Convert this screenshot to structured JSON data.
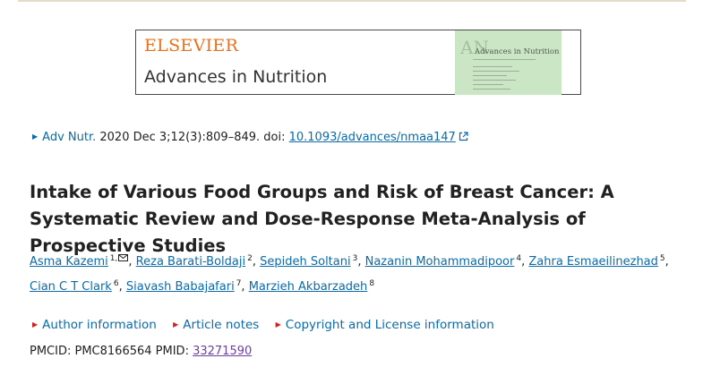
{
  "banner": {
    "publisher": "ELSEVIER",
    "journal": "Advances in Nutrition",
    "cover_title": "Advances in Nutrition",
    "cover_mark": "AN"
  },
  "citation": {
    "journal_abbrev": "Adv Nutr.",
    "details": "2020 Dec 3;12(3):809–849. doi: ",
    "doi": "10.1093/advances/nmaa147"
  },
  "article": {
    "title": "Intake of Various Food Groups and Risk of Breast Cancer: A Systematic Review and Dose-Response Meta-Analysis of Prospective Studies"
  },
  "authors": [
    {
      "name": "Asma Kazemi",
      "sup": "1,"
    },
    {
      "name": "Reza Barati-Boldaji",
      "sup": "2"
    },
    {
      "name": "Sepideh Soltani",
      "sup": "3"
    },
    {
      "name": "Nazanin Mohammadipoor",
      "sup": "4"
    },
    {
      "name": "Zahra Esmaeilinezhad",
      "sup": "5"
    },
    {
      "name": "Cian C T Clark",
      "sup": "6"
    },
    {
      "name": "Siavash Babajafari",
      "sup": "7"
    },
    {
      "name": "Marzieh Akbarzadeh",
      "sup": "8"
    }
  ],
  "sections": {
    "author_info": "Author information",
    "article_notes": "Article notes",
    "copyright": "Copyright and License information"
  },
  "ids": {
    "pmcid_label": "PMCID: ",
    "pmcid": "PMC8166564",
    "pmid_label": "PMID: ",
    "pmid": "33271590"
  },
  "colors": {
    "link": "#0b6aa8",
    "publisher": "#e9711c",
    "visited": "#6a3fa0",
    "accent": "#d12020"
  }
}
